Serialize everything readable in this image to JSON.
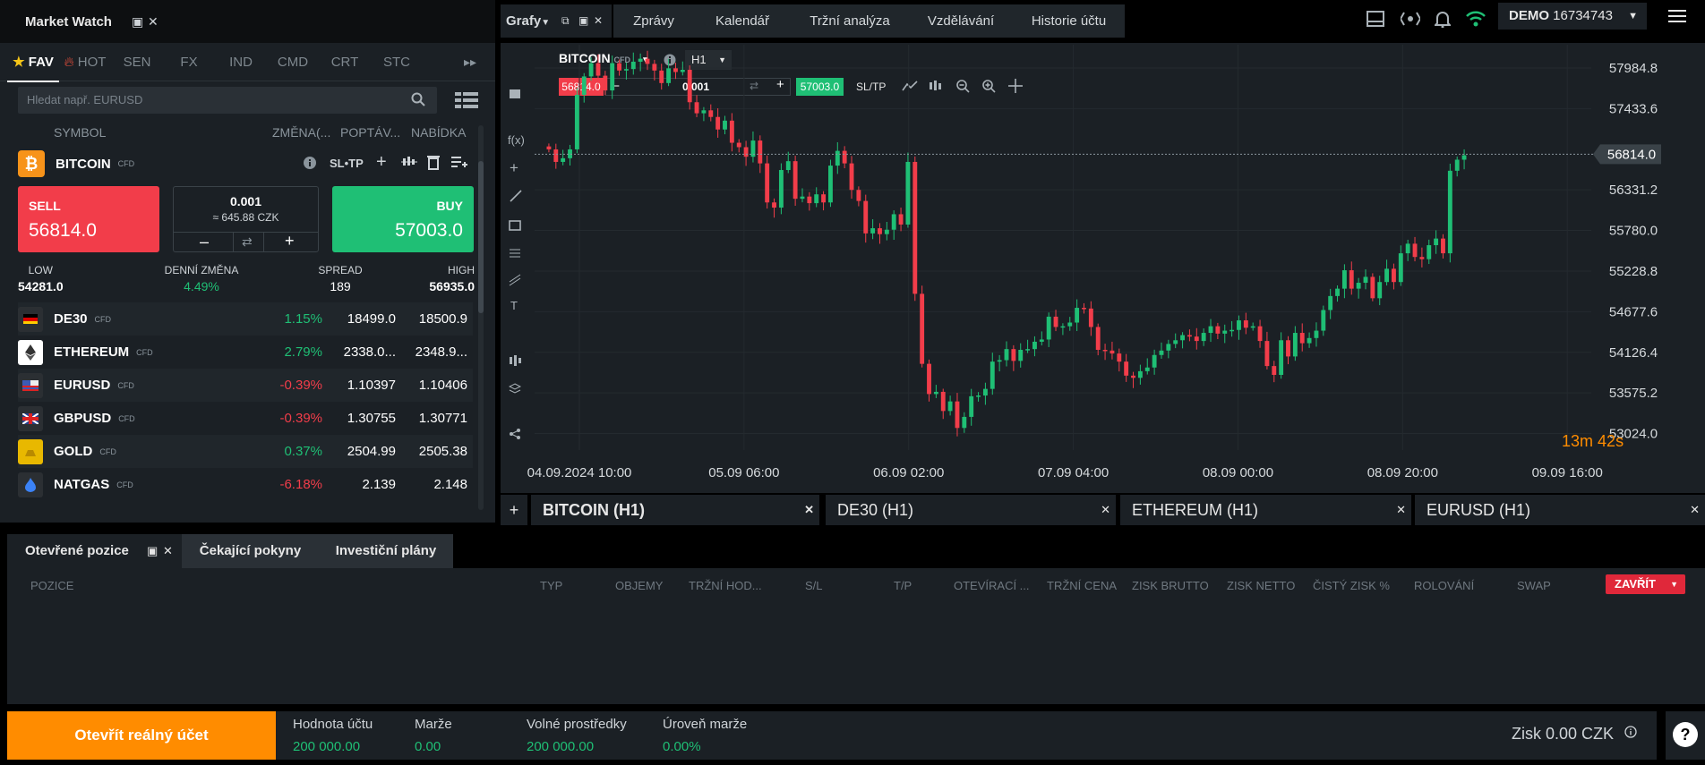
{
  "market_watch": {
    "title": "Market Watch",
    "tabs": [
      "FAV",
      "HOT",
      "SEN",
      "FX",
      "IND",
      "CMD",
      "CRT",
      "STC"
    ],
    "search_placeholder": "Hledat např. EURUSD",
    "columns": {
      "symbol": "SYMBOL",
      "change": "ZMĚNA(...",
      "bid": "POPTÁV...",
      "ask": "NABÍDKA"
    },
    "selected": {
      "name": "BITCOIN",
      "tag": "CFD",
      "sltp": "SL•TP",
      "sell_label": "SELL",
      "sell_price": "56814.0",
      "volume": "0.001",
      "volume_value": "≈ 645.88 CZK",
      "buy_label": "BUY",
      "buy_price": "57003.0",
      "low_label": "LOW",
      "low": "54281.0",
      "daily_label": "DENNÍ ZMĚNA",
      "daily": "4.49%",
      "spread_label": "SPREAD",
      "spread": "189",
      "high_label": "HIGH",
      "high": "56935.0"
    },
    "instruments": [
      {
        "name": "DE30",
        "tag": "CFD",
        "change": "1.15%",
        "bid": "18499.0",
        "ask": "18500.9",
        "dir": "up"
      },
      {
        "name": "ETHEREUM",
        "tag": "CFD",
        "change": "2.79%",
        "bid": "2338.0...",
        "ask": "2348.9...",
        "dir": "up"
      },
      {
        "name": "EURUSD",
        "tag": "CFD",
        "change": "-0.39%",
        "bid": "1.10397",
        "ask": "1.10406",
        "dir": "down"
      },
      {
        "name": "GBPUSD",
        "tag": "CFD",
        "change": "-0.39%",
        "bid": "1.30755",
        "ask": "1.30771",
        "dir": "down"
      },
      {
        "name": "GOLD",
        "tag": "CFD",
        "change": "0.37%",
        "bid": "2504.99",
        "ask": "2505.38",
        "dir": "up"
      },
      {
        "name": "NATGAS",
        "tag": "CFD",
        "change": "-6.18%",
        "bid": "2.139",
        "ask": "2.148",
        "dir": "down"
      }
    ]
  },
  "chart": {
    "grafy": "Grafy",
    "nav": [
      "Zprávy",
      "Kalendář",
      "Tržní analýza",
      "Vzdělávání",
      "Historie účtu"
    ],
    "account_mode": "DEMO",
    "account_id": "16734743",
    "symbol": "BITCOIN",
    "tag": "CFD",
    "timeframe": "H1",
    "sell_price": "56814.0",
    "volume": "0.001",
    "buy_price": "57003.0",
    "sltp": "SL/TP",
    "price_ticks": [
      "57984.8",
      "57433.6",
      "56331.2",
      "55780.0",
      "55228.8",
      "54677.6",
      "54126.4",
      "53575.2",
      "53024.0"
    ],
    "current_price": "56814.0",
    "time_ticks": [
      "04.09.2024 10:00",
      "05.09 06:00",
      "06.09 02:00",
      "07.09 04:00",
      "08.09 00:00",
      "08.09 20:00",
      "09.09 16:00"
    ],
    "countdown_min": "13",
    "countdown_m": "m",
    "countdown_sec": "42",
    "countdown_s": "s",
    "bottom_tabs": [
      "BITCOIN (H1)",
      "DE30 (H1)",
      "ETHEREUM (H1)",
      "EURUSD (H1)"
    ]
  },
  "positions": {
    "tabs": [
      "Otevřené pozice",
      "Čekající pokyny",
      "Investiční plány"
    ],
    "columns": [
      "POZICE",
      "TYP",
      "OBJEMY",
      "TRŽNÍ HOD...",
      "S/L",
      "T/P",
      "OTEVÍRACÍ ...",
      "TRŽNÍ CENA",
      "ZISK BRUTTO",
      "ZISK NETTO",
      "ČISTÝ ZISK %",
      "ROLOVÁNÍ",
      "SWAP"
    ],
    "close_label": "ZAVŘÍT"
  },
  "footer": {
    "open_real": "Otevřít reálný účet",
    "items": [
      {
        "label": "Hodnota účtu",
        "value": "200 000.00"
      },
      {
        "label": "Marže",
        "value": "0.00"
      },
      {
        "label": "Volné prostředky",
        "value": "200 000.00"
      },
      {
        "label": "Úroveň marže",
        "value": "0.00%"
      }
    ],
    "profit": "Zisk 0.00 CZK",
    "help": "?"
  },
  "colors": {
    "green": "#1fbf75",
    "red": "#f23d4a",
    "orange": "#ff8c00",
    "bg": "#1b2025"
  },
  "chart_data": {
    "type": "candlestick",
    "xlabel": "",
    "ylabel": "",
    "ylim": [
      52800,
      58300
    ],
    "x": [
      "04.09.2024 10:00",
      "05.09 06:00",
      "06.09 02:00",
      "07.09 04:00",
      "08.09 00:00",
      "08.09 20:00",
      "09.09 16:00"
    ],
    "series": [
      {
        "values": [
          56880,
          56710,
          56760,
          56880,
          57620,
          57870,
          58050,
          57880,
          57680,
          58050,
          57950,
          57970,
          58070,
          58110,
          58040,
          57950,
          57780,
          57980,
          57930,
          57960,
          57520,
          57370,
          57410,
          57320,
          57150,
          57270,
          56970,
          56910,
          56780,
          57000,
          56690,
          56160,
          56090,
          56600,
          56720,
          56210,
          56240,
          56150,
          56270,
          56160,
          56660,
          56860,
          56690,
          56330,
          56180,
          55740,
          55810,
          55730,
          55790,
          56000,
          55860,
          56710,
          54920,
          53970,
          53560,
          53590,
          53330,
          53460,
          53100,
          53250,
          53530,
          53540,
          53630,
          54000,
          54020,
          54170,
          54010,
          54160,
          54170,
          54270,
          54300,
          54610,
          54470,
          54480,
          54530,
          54730,
          54720,
          54470,
          54160,
          54150,
          54110,
          54000,
          53810,
          53780,
          53870,
          53920,
          54090,
          54150,
          54240,
          54290,
          54360,
          54340,
          54280,
          54390,
          54480,
          54380,
          54420,
          54430,
          54560,
          54460,
          54480,
          54280,
          53940,
          53820,
          54290,
          54070,
          54390,
          54250,
          54320,
          54420,
          54700,
          54890,
          54990,
          55240,
          54990,
          55070,
          55150,
          54860,
          55080,
          55260,
          55080,
          55470,
          55600,
          55420,
          55390,
          55580,
          55670,
          55470,
          56590,
          56740,
          56800
        ]
      }
    ]
  }
}
